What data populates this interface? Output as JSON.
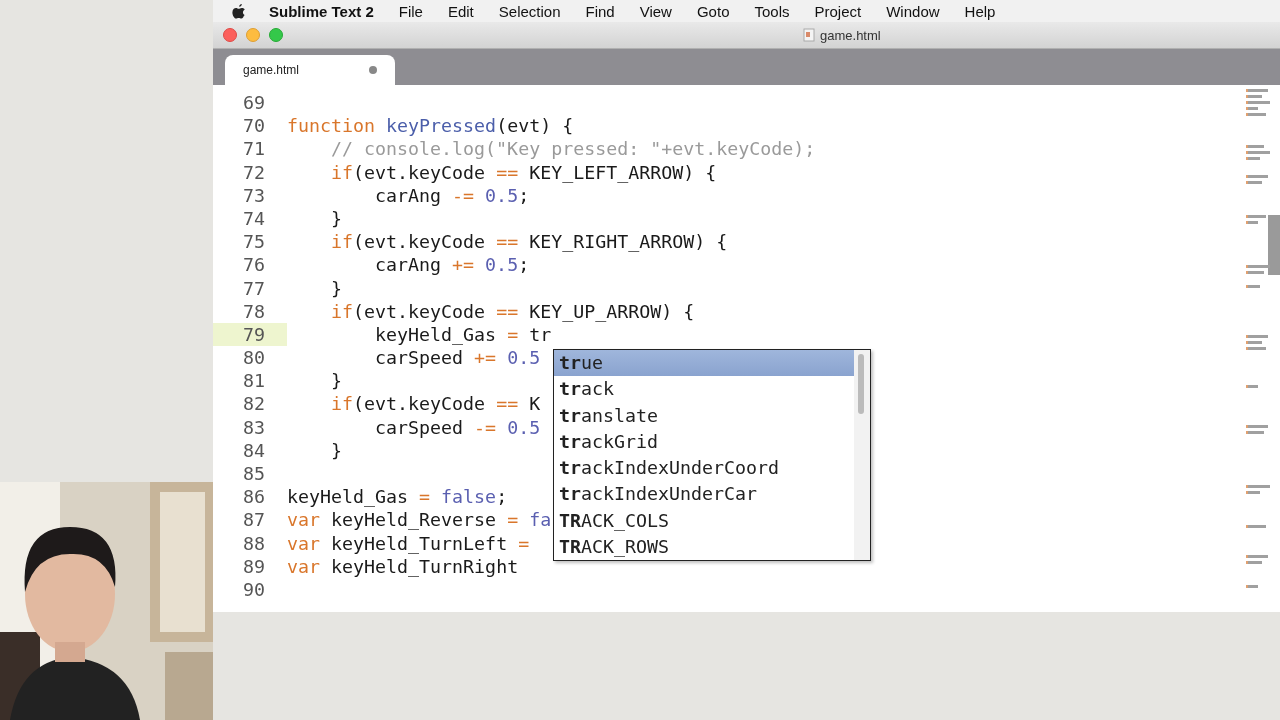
{
  "menubar": {
    "app": "Sublime Text 2",
    "items": [
      "File",
      "Edit",
      "Selection",
      "Find",
      "View",
      "Goto",
      "Tools",
      "Project",
      "Window",
      "Help"
    ]
  },
  "window": {
    "title": "game.html"
  },
  "tabs": [
    {
      "label": "game.html",
      "selected": true,
      "modified": true
    }
  ],
  "editor": {
    "lines": [
      {
        "number": "69",
        "current": false
      },
      {
        "number": "70",
        "current": false,
        "tokens": [
          {
            "kind": "keyword",
            "text": "function"
          },
          {
            "kind": "function",
            "text": " keyPressed"
          },
          {
            "kind": "plain",
            "text": "(evt) {"
          }
        ]
      },
      {
        "number": "71",
        "current": false,
        "tokens": [
          {
            "kind": "comment",
            "text": "    // console.log(\"Key pressed: \"+evt.keyCode);"
          }
        ]
      },
      {
        "number": "72",
        "current": false,
        "tokens": [
          {
            "kind": "keyword",
            "text": "    if"
          },
          {
            "kind": "plain",
            "text": "(evt.keyCode "
          },
          {
            "kind": "operator",
            "text": "=="
          },
          {
            "kind": "plain",
            "text": " KEY_LEFT_ARROW) {"
          }
        ]
      },
      {
        "number": "73",
        "current": false,
        "tokens": [
          {
            "kind": "plain",
            "text": "        carAng "
          },
          {
            "kind": "operator",
            "text": "-="
          },
          {
            "kind": "constant",
            "text": " 0.5"
          },
          {
            "kind": "plain",
            "text": ";"
          }
        ]
      },
      {
        "number": "74",
        "current": false,
        "tokens": [
          {
            "kind": "plain",
            "text": "    }"
          }
        ]
      },
      {
        "number": "75",
        "current": false,
        "tokens": [
          {
            "kind": "keyword",
            "text": "    if"
          },
          {
            "kind": "plain",
            "text": "(evt.keyCode "
          },
          {
            "kind": "operator",
            "text": "=="
          },
          {
            "kind": "plain",
            "text": " KEY_RIGHT_ARROW) {"
          }
        ]
      },
      {
        "number": "76",
        "current": false,
        "tokens": [
          {
            "kind": "plain",
            "text": "        carAng "
          },
          {
            "kind": "operator",
            "text": "+="
          },
          {
            "kind": "constant",
            "text": " 0.5"
          },
          {
            "kind": "plain",
            "text": ";"
          }
        ]
      },
      {
        "number": "77",
        "current": false,
        "tokens": [
          {
            "kind": "plain",
            "text": "    }"
          }
        ]
      },
      {
        "number": "78",
        "current": false,
        "tokens": [
          {
            "kind": "keyword",
            "text": "    if"
          },
          {
            "kind": "plain",
            "text": "(evt.keyCode "
          },
          {
            "kind": "operator",
            "text": "=="
          },
          {
            "kind": "plain",
            "text": " KEY_UP_ARROW) {"
          }
        ]
      },
      {
        "number": "79",
        "current": true,
        "tokens": [
          {
            "kind": "plain",
            "text": "        keyHeld_Gas "
          },
          {
            "kind": "operator",
            "text": "="
          },
          {
            "kind": "plain",
            "text": " tr"
          }
        ]
      },
      {
        "number": "80",
        "current": false,
        "tokens": [
          {
            "kind": "plain",
            "text": "        carSpeed "
          },
          {
            "kind": "operator",
            "text": "+="
          },
          {
            "kind": "constant",
            "text": " 0.5"
          }
        ]
      },
      {
        "number": "81",
        "current": false,
        "tokens": [
          {
            "kind": "plain",
            "text": "    }"
          }
        ]
      },
      {
        "number": "82",
        "current": false,
        "tokens": [
          {
            "kind": "keyword",
            "text": "    if"
          },
          {
            "kind": "plain",
            "text": "(evt.keyCode "
          },
          {
            "kind": "operator",
            "text": "=="
          },
          {
            "kind": "plain",
            "text": " K"
          }
        ]
      },
      {
        "number": "83",
        "current": false,
        "tokens": [
          {
            "kind": "plain",
            "text": "        carSpeed "
          },
          {
            "kind": "operator",
            "text": "-="
          },
          {
            "kind": "constant",
            "text": " 0.5"
          }
        ]
      },
      {
        "number": "84",
        "current": false,
        "tokens": [
          {
            "kind": "plain",
            "text": "    }"
          }
        ]
      },
      {
        "number": "85",
        "current": false
      },
      {
        "number": "86",
        "current": false,
        "tokens": [
          {
            "kind": "plain",
            "text": "keyHeld_Gas "
          },
          {
            "kind": "operator",
            "text": "="
          },
          {
            "kind": "constant",
            "text": " false"
          },
          {
            "kind": "plain",
            "text": ";"
          }
        ]
      },
      {
        "number": "87",
        "current": false,
        "tokens": [
          {
            "kind": "keyword",
            "text": "var"
          },
          {
            "kind": "plain",
            "text": " keyHeld_Reverse "
          },
          {
            "kind": "operator",
            "text": "="
          },
          {
            "kind": "constant",
            "text": " fa"
          }
        ]
      },
      {
        "number": "88",
        "current": false,
        "tokens": [
          {
            "kind": "keyword",
            "text": "var"
          },
          {
            "kind": "plain",
            "text": " keyHeld_TurnLeft "
          },
          {
            "kind": "operator",
            "text": "="
          }
        ]
      },
      {
        "number": "89",
        "current": false,
        "tokens": [
          {
            "kind": "keyword",
            "text": "var"
          },
          {
            "kind": "plain",
            "text": " keyHeld_TurnRight"
          }
        ]
      },
      {
        "number": "90",
        "current": false
      }
    ]
  },
  "autocomplete": {
    "items": [
      {
        "label": "**tr**ue",
        "selected": true
      },
      {
        "label": "**tr**ack",
        "selected": false
      },
      {
        "label": "**tr**anslate",
        "selected": false
      },
      {
        "label": "**tr**ackGrid",
        "selected": false
      },
      {
        "label": "**tr**ackIndexUnderCoord",
        "selected": false
      },
      {
        "label": "**tr**ackIndexUnderCar",
        "selected": false
      },
      {
        "label": "**TR**ACK_COLS",
        "selected": false
      },
      {
        "label": "**TR**ACK_ROWS",
        "selected": false
      }
    ]
  }
}
